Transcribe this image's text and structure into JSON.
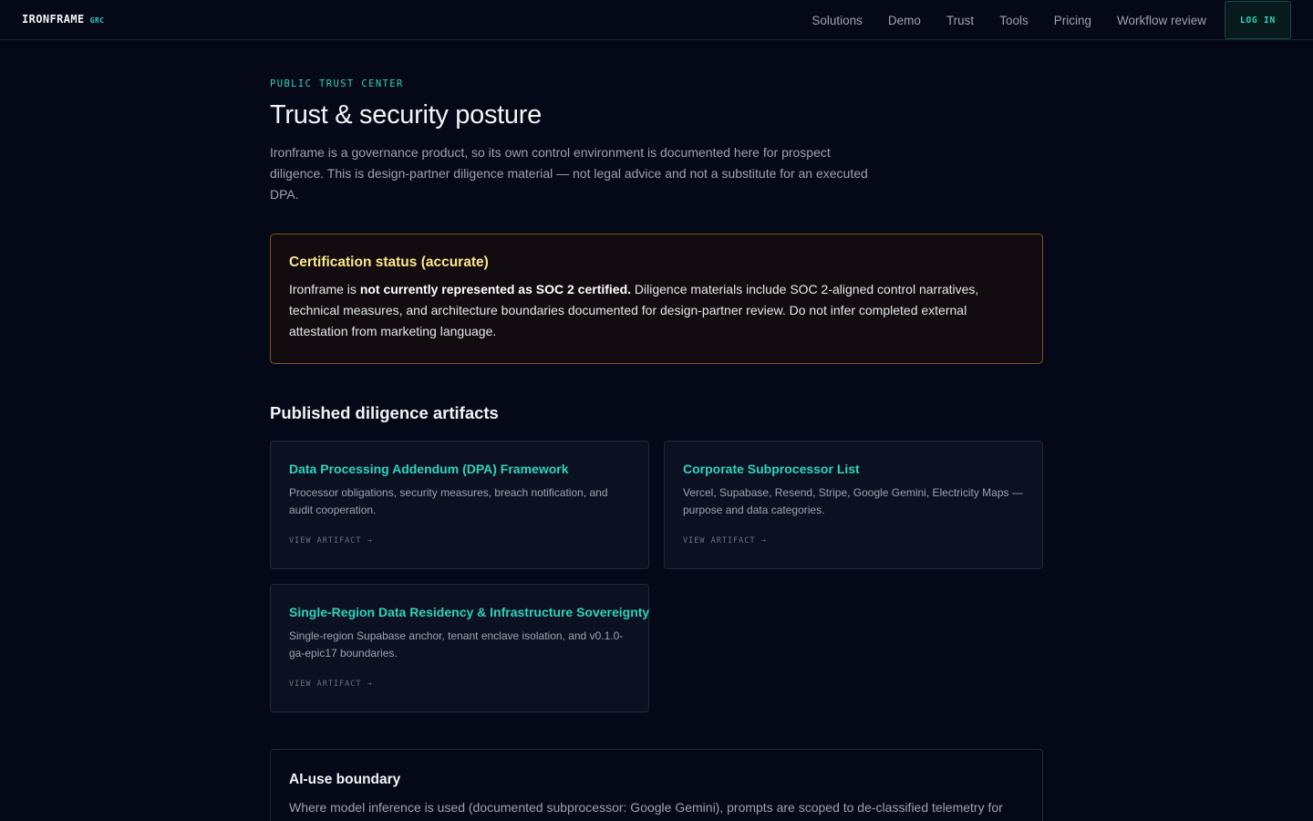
{
  "nav": {
    "brand": "IRONFRAME",
    "brand_tag": "GRC",
    "links": [
      "Solutions",
      "Demo",
      "Trust",
      "Tools",
      "Pricing",
      "Workflow review"
    ],
    "login": "LOG IN"
  },
  "hero": {
    "eyebrow": "PUBLIC TRUST CENTER",
    "title": "Trust & security posture",
    "intro": "Ironframe is a governance product, so its own control environment is documented here for prospect diligence. This is design-partner diligence material — not legal advice and not a substitute for an executed DPA."
  },
  "certification": {
    "title": "Certification status (accurate)",
    "body_prefix": "Ironframe is ",
    "body_strong": "not currently represented as SOC 2 certified.",
    "body_suffix": " Diligence materials include SOC 2-aligned control narratives, technical measures, and architecture boundaries documented for design-partner review. Do not infer completed external attestation from marketing language."
  },
  "artifacts": {
    "section_title": "Published diligence artifacts",
    "items": [
      {
        "title": "Data Processing Addendum (DPA) Framework",
        "description": "Processor obligations, security measures, breach notification, and audit cooperation.",
        "link": "VIEW ARTIFACT →"
      },
      {
        "title": "Corporate Subprocessor List",
        "description": "Vercel, Supabase, Resend, Stripe, Google Gemini, Electricity Maps — purpose and data categories.",
        "link": "VIEW ARTIFACT →"
      },
      {
        "title": "Single-Region Data Residency & Infrastructure Sovereignty",
        "description": "Single-region Supabase anchor, tenant enclave isolation, and v0.1.0-ga-epic17 boundaries.",
        "link": "VIEW ARTIFACT →"
      }
    ]
  },
  "ai_boundary": {
    "title": "AI-use boundary",
    "body": "Where model inference is used (documented subprocessor: Google Gemini), prompts are scoped to de-classified telemetry for"
  }
}
